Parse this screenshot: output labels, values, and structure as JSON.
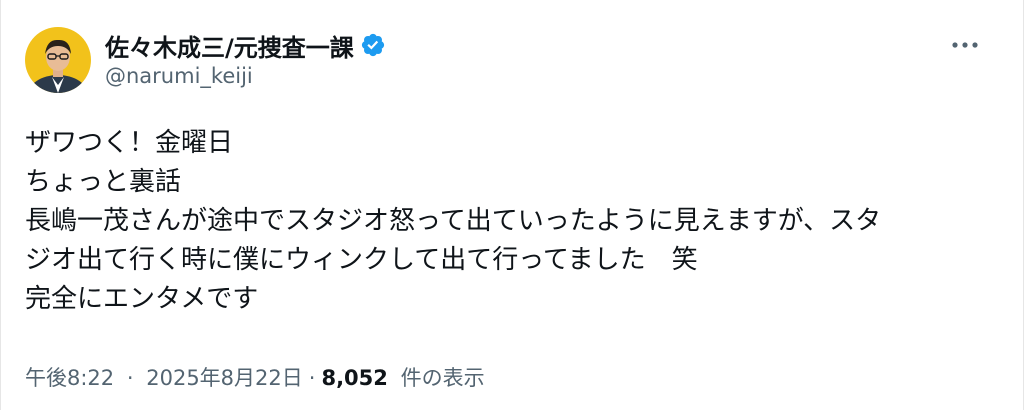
{
  "author": {
    "display_name": "佐々木成三/元捜査一課",
    "handle": "@narumi_keiji",
    "verified_icon": "verified-badge-icon",
    "avatar_bg": "#f2c21b"
  },
  "tweet": {
    "lines": [
      "ザワつく！金曜日",
      "ちょっと裏話",
      "長嶋一茂さんが途中でスタジオ怒って出ていったように見えますが、スタ",
      "ジオ出て行く時に僕にウィンクして出て行ってました　笑",
      "完全にエンタメです"
    ]
  },
  "meta": {
    "time": "午後8:22",
    "separator": "·",
    "date": "2025年8月22日",
    "views_count": "8,052",
    "views_label": "件の表示"
  },
  "colors": {
    "text": "#0f1419",
    "muted": "#536471",
    "verified": "#1d9bf0"
  }
}
